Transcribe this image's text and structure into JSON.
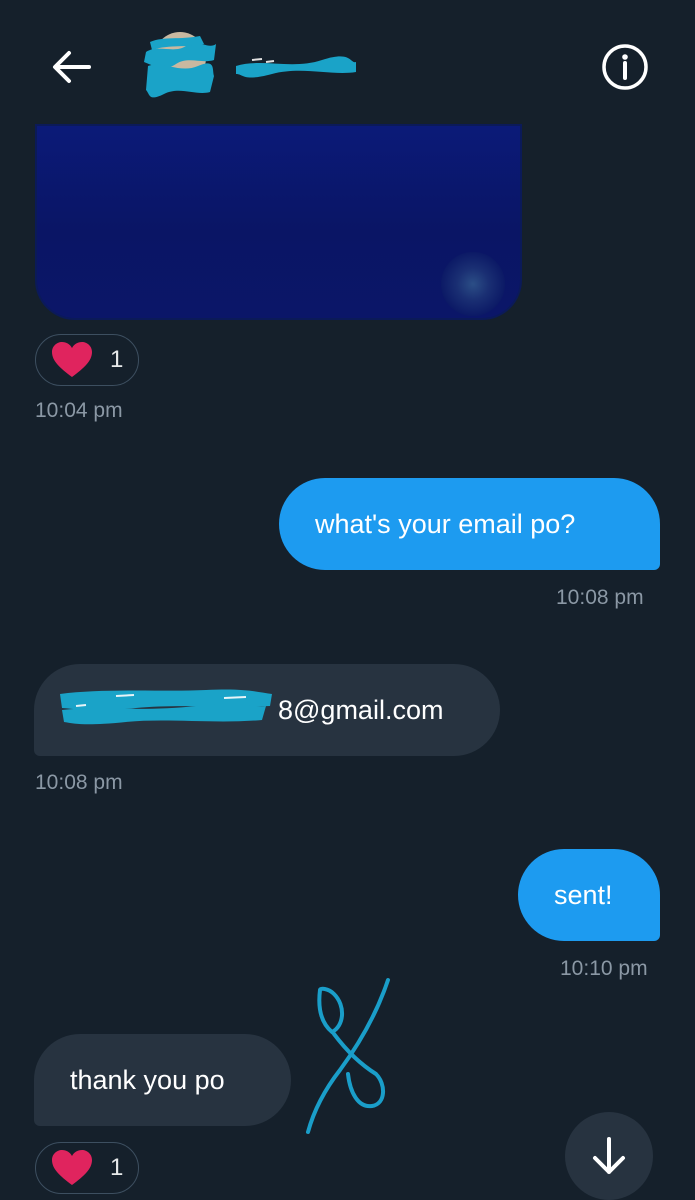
{
  "header": {
    "back_icon": "arrow-left-icon",
    "info_icon": "info-circle-icon"
  },
  "messages": [
    {
      "type": "media",
      "direction": "in",
      "reaction": {
        "icon": "heart-icon",
        "count": "1"
      },
      "time": "10:04 pm"
    },
    {
      "type": "text",
      "direction": "out",
      "text": "what's your email po?",
      "time": "10:08 pm"
    },
    {
      "type": "text",
      "direction": "in",
      "text": "8@gmail.com",
      "time": "10:08 pm"
    },
    {
      "type": "text",
      "direction": "out",
      "text": "sent!",
      "time": "10:10 pm"
    },
    {
      "type": "text",
      "direction": "in",
      "text": "thank you po",
      "reaction": {
        "icon": "heart-icon",
        "count": "1"
      }
    }
  ],
  "colors": {
    "background": "#15202b",
    "outgoing_bubble": "#1d9bf0",
    "incoming_bubble": "#273340",
    "timestamp": "#8b98a5",
    "heart": "#f91880",
    "redaction": "#1aa3c8"
  },
  "scroll_button": {
    "icon": "arrow-down-icon"
  }
}
